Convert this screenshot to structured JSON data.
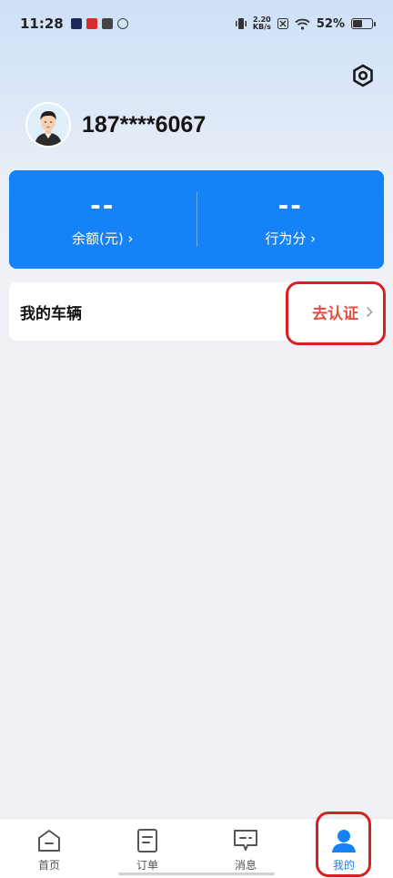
{
  "status_bar": {
    "time": "11:28",
    "net_speed_value": "2.20",
    "net_speed_unit": "KB/s",
    "battery": "52%",
    "battery_level": 0.52
  },
  "profile": {
    "phone": "187****6067"
  },
  "stats": {
    "balance_value": "--",
    "balance_label": "余额(元) ›",
    "score_value": "--",
    "score_label": "行为分 ›"
  },
  "vehicle": {
    "title": "我的车辆",
    "action_label": "去认证"
  },
  "tabs": [
    {
      "label": "首页",
      "icon": "home-icon",
      "active": false
    },
    {
      "label": "订单",
      "icon": "order-icon",
      "active": false
    },
    {
      "label": "消息",
      "icon": "message-icon",
      "active": false
    },
    {
      "label": "我的",
      "icon": "profile-icon",
      "active": true
    }
  ],
  "colors": {
    "accent": "#1583f7",
    "verify": "#e44d3e",
    "highlight": "#d91f1f"
  }
}
